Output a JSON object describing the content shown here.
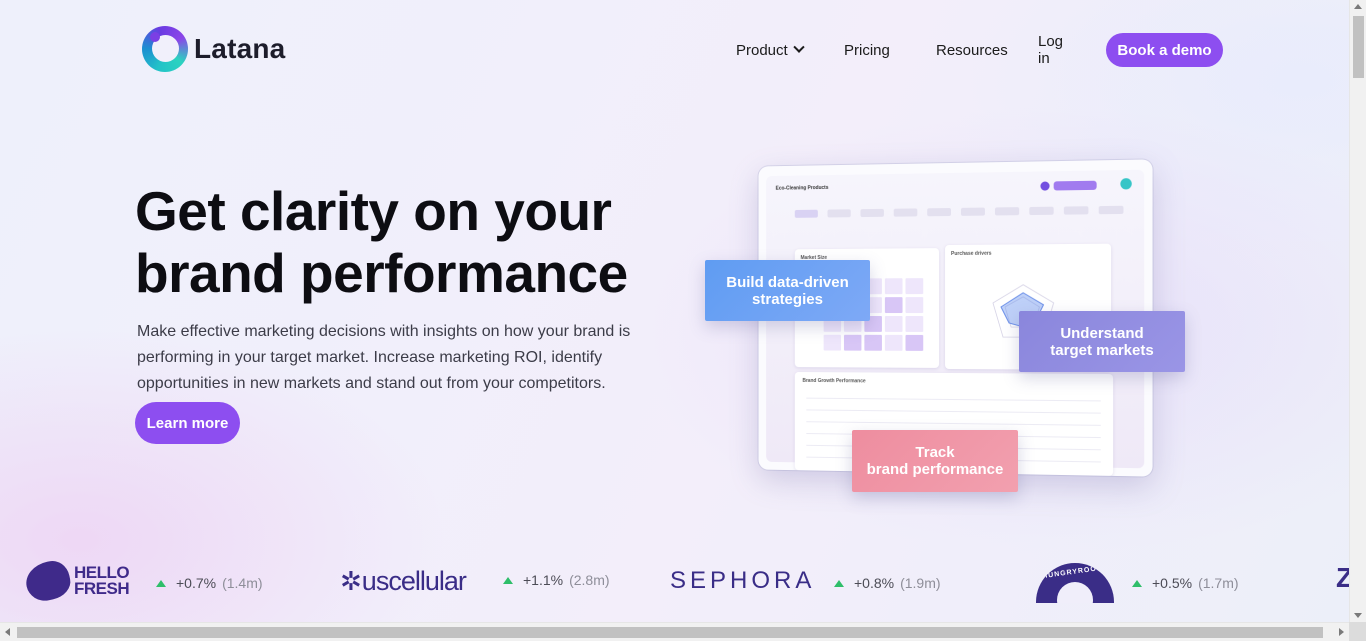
{
  "header": {
    "brand": "Latana",
    "nav": [
      {
        "label": "Product"
      },
      {
        "label": "Pricing"
      },
      {
        "label": "Resources"
      },
      {
        "label": "Log in"
      }
    ],
    "cta": "Book a demo"
  },
  "hero": {
    "title_line1": "Get clarity on your",
    "title_line2": "brand performance",
    "subtitle": "Make effective marketing decisions with insights on how your brand is performing in your target market. Increase marketing ROI, identify opportunities in new markets and stand out from your competitors.",
    "cta": "Learn more"
  },
  "dashboard": {
    "project": "Eco-Cleaning Products",
    "panels": [
      "Market Size",
      "Purchase drivers",
      "Brand Growth Performance"
    ],
    "cards": [
      {
        "line1": "Build data-driven",
        "line2": "strategies",
        "color": "#6aa2f4"
      },
      {
        "line1": "Understand",
        "line2": "target markets",
        "color": "#918ce1"
      },
      {
        "line1": "Track",
        "line2": "brand performance",
        "color": "#f096a6"
      }
    ]
  },
  "customers": [
    {
      "brand": "HELLO FRESH",
      "brand_line1": "HELLO",
      "brand_line2": "FRESH",
      "change": "+0.7%",
      "reach": "(1.4m)"
    },
    {
      "brand": "uscellular",
      "change": "+1.1%",
      "reach": "(2.8m)"
    },
    {
      "brand": "SEPHORA",
      "change": "+0.8%",
      "reach": "(1.9m)"
    },
    {
      "brand": "HUNGRYROOT",
      "change": "+0.5%",
      "reach": "(1.7m)"
    }
  ],
  "colors": {
    "accent": "#8d4ef0",
    "brand_ink": "#3a2d87",
    "positive": "#2fbe6a"
  },
  "icons": {
    "product_menu": "chevron-down-icon",
    "trend": "triangle-up-icon"
  }
}
